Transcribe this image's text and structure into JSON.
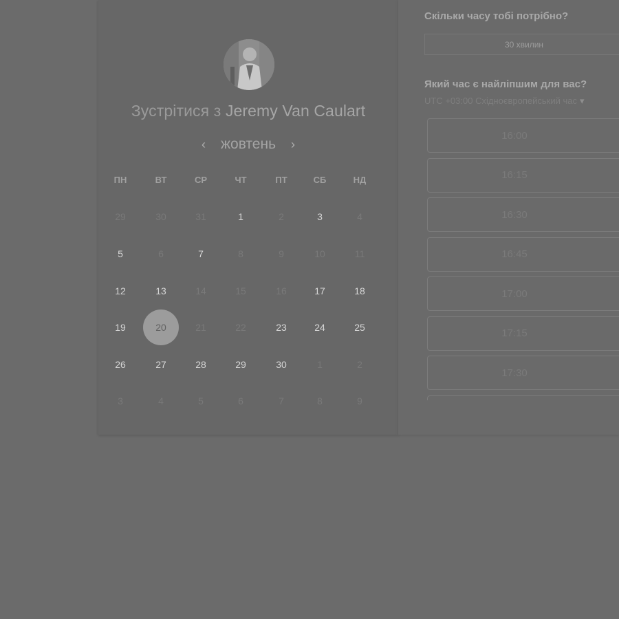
{
  "left_panel": {
    "title_prefix": "Зустрітися з",
    "host_name": "Jeremy Van Caulart",
    "month": "жовтень",
    "prev_icon": "chevron-left-icon",
    "next_icon": "chevron-right-icon",
    "weekdays": [
      "ПН",
      "ВТ",
      "СР",
      "ЧТ",
      "ПТ",
      "СБ",
      "НД"
    ],
    "weeks": [
      [
        "29",
        "30",
        "31",
        "1",
        "2",
        "3",
        "4"
      ],
      [
        "5",
        "6",
        "7",
        "8",
        "9",
        "10",
        "11"
      ],
      [
        "12",
        "13",
        "14",
        "15",
        "16",
        "17",
        "18"
      ],
      [
        "19",
        "20",
        "21",
        "22",
        "23",
        "24",
        "25"
      ],
      [
        "26",
        "27",
        "28",
        "29",
        "30",
        "1",
        "2"
      ],
      [
        "3",
        "4",
        "5",
        "6",
        "7",
        "8",
        "9"
      ]
    ],
    "available_days": [
      "1",
      "3",
      "5",
      "7",
      "12",
      "13",
      "17",
      "18",
      "19",
      "20",
      "23",
      "24",
      "25",
      "26",
      "27",
      "28",
      "29",
      "30"
    ],
    "selected_day": "20"
  },
  "right_panel": {
    "duration_question": "Скільки часу тобі потрібно?",
    "duration_value": "30 хвилин",
    "time_question": "Який час є найліпшим для вас?",
    "timezone": "UTC +03:00 Східноєвропейський час",
    "timezone_caret_icon": "caret-down-icon",
    "slots": [
      "16:00",
      "16:15",
      "16:30",
      "16:45",
      "17:00",
      "17:15",
      "17:30",
      ""
    ]
  }
}
